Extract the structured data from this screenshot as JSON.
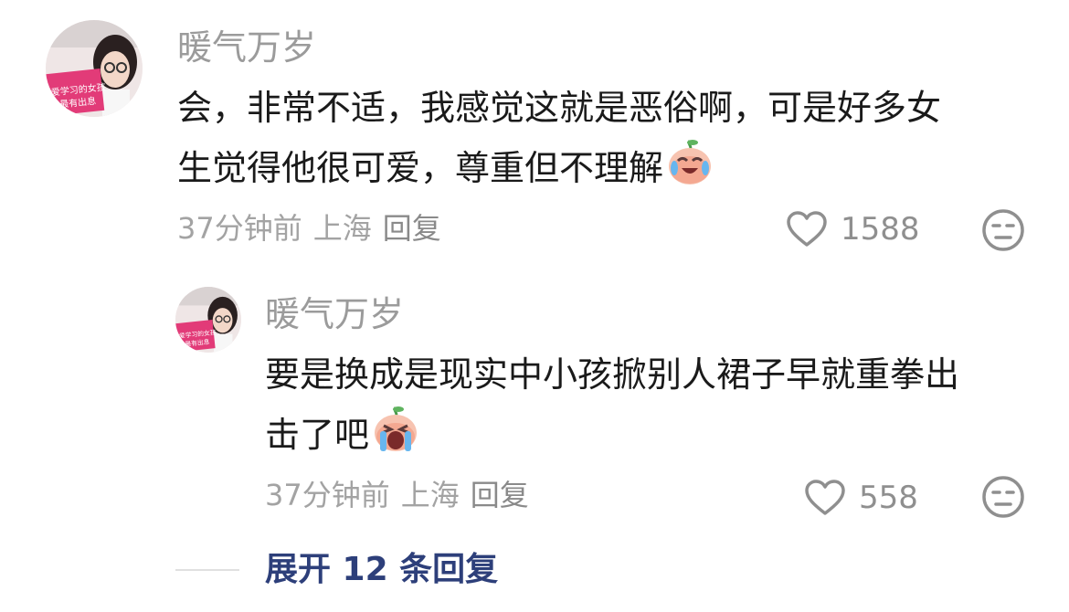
{
  "comments": [
    {
      "author": "暖气万岁",
      "content_lines": [
        "会，非常不适，我感觉这就是恶俗啊，可是好多女",
        "生觉得他很可爱，尊重但不理解"
      ],
      "emoji": "crying-laughing-emoji",
      "time": "37分钟前",
      "location": "上海",
      "reply_label": "回复",
      "likes": "1588",
      "avatar_book_text": [
        "爱学习的女孩",
        "最有出息"
      ]
    },
    {
      "author": "暖气万岁",
      "content_lines": [
        "要是换成是现实中小孩掀别人裙子早就重拳出",
        "击了吧"
      ],
      "emoji": "loud-crying-emoji",
      "time": "37分钟前",
      "location": "上海",
      "reply_label": "回复",
      "likes": "558",
      "avatar_book_text": [
        "爱学习的女孩",
        "最有出息"
      ]
    }
  ],
  "expand_replies": "展开 12 条回复",
  "icons": {
    "like": "heart-outline-icon",
    "reaction": "unamused-face-icon"
  },
  "colors": {
    "name": "#9b9b9b",
    "text": "#1a1a1a",
    "meta": "#a3a3a3",
    "link": "#2d3f7a"
  }
}
